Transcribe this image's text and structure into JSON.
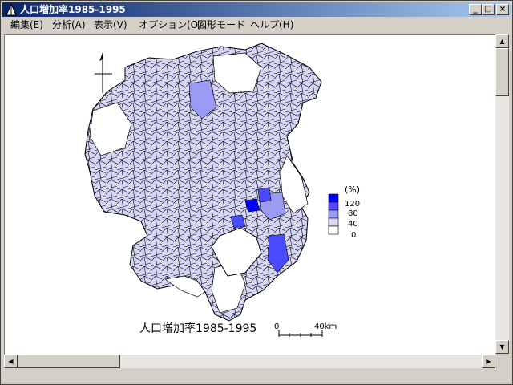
{
  "window": {
    "title": "人口増加率1985-1995",
    "controls": {
      "minimize": "_",
      "maximize": "□",
      "close": "×"
    }
  },
  "menu": [
    {
      "label": "編集(E)"
    },
    {
      "label": "分析(A)"
    },
    {
      "label": "表示(V)"
    },
    {
      "label": "オプション(O)"
    },
    {
      "label": "図形モード"
    },
    {
      "label": "ヘルプ(H)"
    }
  ],
  "map": {
    "title": "人口増加率1985-1995",
    "legend": {
      "unit": "(%)",
      "classes": [
        {
          "label": "120",
          "color": "#0000ff"
        },
        {
          "label": "80",
          "color": "#4a4aff"
        },
        {
          "label": "40",
          "color": "#9b9bf5"
        },
        {
          "label": "",
          "color": "#d6d6f7"
        },
        {
          "label": "0",
          "color": "#ffffff"
        }
      ]
    },
    "scale": {
      "start": "0",
      "end": "40km"
    },
    "colors": {
      "land_light": "#d6d6f7",
      "land_medium": "#9b9bf5",
      "land_dark": "#4a4aff",
      "land_max": "#0000ff",
      "border": "#000000"
    }
  }
}
